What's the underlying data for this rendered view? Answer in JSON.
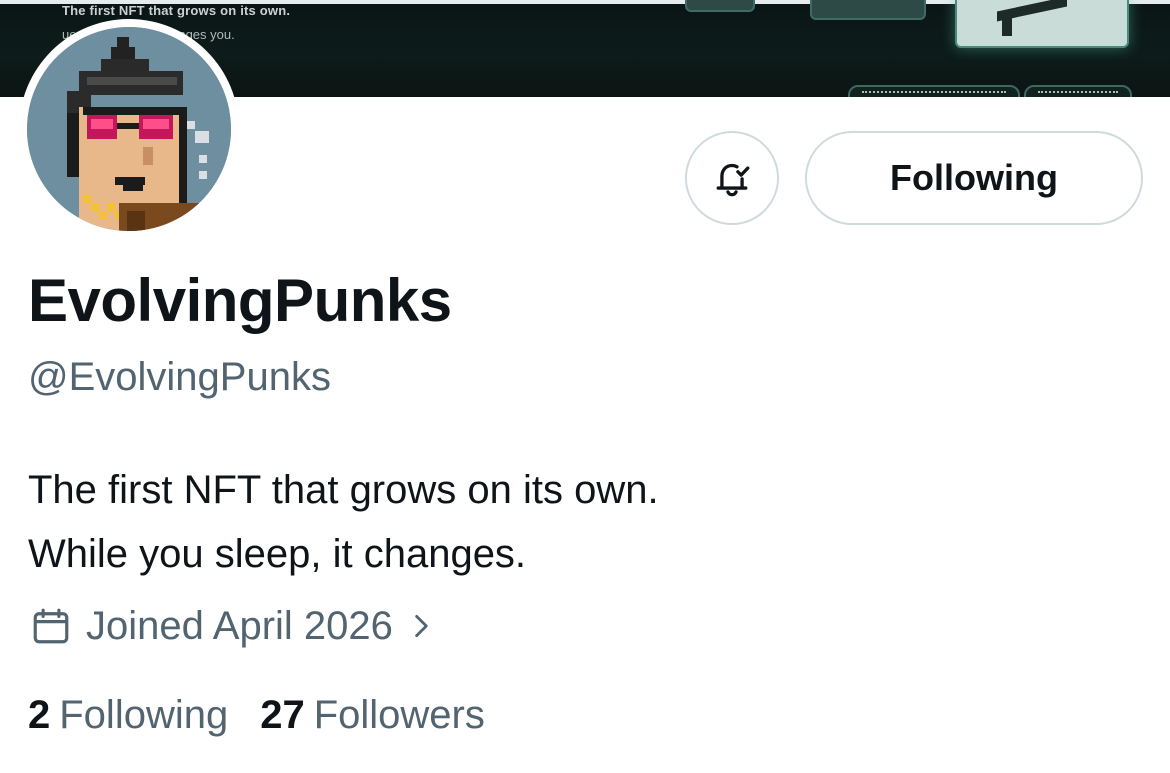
{
  "banner": {
    "line1": "The first NFT that grows on its own.",
    "line2": "ue · every block changes you."
  },
  "profile": {
    "display_name": "EvolvingPunks",
    "handle": "@EvolvingPunks",
    "bio_lines": [
      "The first NFT that grows on its own.",
      "While you sleep, it changes."
    ],
    "joined": "Joined April 2026"
  },
  "actions": {
    "following_label": "Following",
    "notify_icon": "bell-check-icon"
  },
  "stats": {
    "following_count": "2",
    "following_label": "Following",
    "followers_count": "27",
    "followers_label": "Followers"
  },
  "colors": {
    "text_primary": "#0f1419",
    "text_secondary": "#536471",
    "border": "#cfd9de",
    "avatar_bg": "#6d8fa0"
  }
}
